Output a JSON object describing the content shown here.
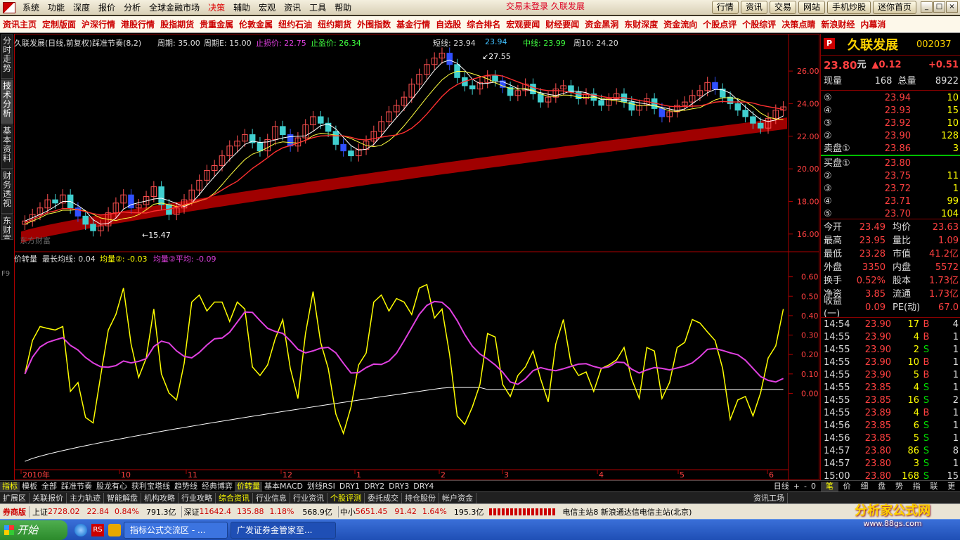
{
  "menubar": {
    "items": [
      "系统",
      "功能",
      "深度",
      "报价",
      "分析",
      "全球金融市场",
      "决策",
      "辅助",
      "宏观",
      "资讯",
      "工具",
      "帮助"
    ],
    "center_title": "交易未登录 久联发展",
    "right_buttons": [
      "行情",
      "资讯",
      "交易",
      "网站",
      "手机炒股",
      "迷你首页"
    ]
  },
  "quick_bar": [
    "资讯主页",
    "定制版面",
    "沪深行情",
    "港股行情",
    "股指期货",
    "贵重金属",
    "伦敦金属",
    "纽约石油",
    "纽约期货",
    "外围指数",
    "基金行情",
    "自选股",
    "综合排名",
    "宏观要闻",
    "财经要闻",
    "资金黑洞",
    "东财深度",
    "资金流向",
    "个股点评",
    "个股综评",
    "决策点睛",
    "新浪财经",
    "内幕消"
  ],
  "left_tabs": [
    "分时走势",
    "技术分析",
    "基本资料",
    "财务透视",
    "东财富"
  ],
  "left_f9": "F9",
  "main_chart": {
    "title": "久联发展(日线,前复权)踩准节奏(8,2)",
    "period_label": "周期:",
    "period_value": "35.00",
    "period_e_label": "周期E:",
    "period_e_value": "15.00",
    "stop_loss_label": "止损价:",
    "stop_loss_value": "22.75",
    "take_profit_label": "止盈价:",
    "take_profit_value": "26.34",
    "short_label": "短线:",
    "short_value": "23.94",
    "short_value2": "23.94",
    "mid_label": "中线:",
    "mid_value": "23.99",
    "week_label": "周10:",
    "week_value": "24.20",
    "high_marker": "27.55",
    "low_marker": "15.47",
    "watermark_text": "东方财富"
  },
  "indicator": {
    "name": "价转量",
    "long_ma_label": "最长均线:",
    "long_ma_value": "0.04",
    "ma2_label": "均量②:",
    "ma2_value": "-0.03",
    "ma2_avg_label": "均量②平均:",
    "ma2_avg_value": "-0.09"
  },
  "chart_data": [
    {
      "type": "candlestick",
      "title": "久联发展(日线,前复权)",
      "ylim": [
        15,
        27.6
      ],
      "y_ticks": [
        16,
        18,
        20,
        22,
        24,
        26
      ],
      "x_labels": [
        "2010年",
        "10",
        "11",
        "12",
        "1",
        "2",
        "3",
        "4",
        "5",
        "6"
      ],
      "ohlc_close_path": [
        16.8,
        17.2,
        17.6,
        18.1,
        17.9,
        18.4,
        17.6,
        17.1,
        16.6,
        16.2,
        16.5,
        17.3,
        17.9,
        18.4,
        17.6,
        17.8,
        18.3,
        18.9,
        17.8,
        17.2,
        17.6,
        18.1,
        18.7,
        19.3,
        19.9,
        20.2,
        20.8,
        21.4,
        21.7,
        22.1,
        21.6,
        21.1,
        21.8,
        22.6,
        22.1,
        21.4,
        21.9,
        22.7,
        23.2,
        22.8,
        22.3,
        21.5,
        21.1,
        20.8,
        21.2,
        21.7,
        22.3,
        22.9,
        23.5,
        23.9,
        24.4,
        25.2,
        25.8,
        26.4,
        26.8,
        27.1,
        26.4,
        25.6,
        25.1,
        24.9,
        25.3,
        25.7,
        25.4,
        25.0,
        24.5,
        24.8,
        25.2,
        24.6,
        24.1,
        24.4,
        24.9,
        25.1,
        24.7,
        24.3,
        24.6,
        24.2,
        23.9,
        24.3,
        24.6,
        24.1,
        23.6,
        23.9,
        24.3,
        23.7,
        23.2,
        23.5,
        23.9,
        24.1,
        24.5,
        24.8,
        25.3,
        24.9,
        24.4,
        24.0,
        23.6,
        23.2,
        22.8,
        22.5,
        23.1,
        23.6,
        23.8
      ],
      "ma_long_range": [
        15.8,
        22.8
      ],
      "indicator_ylim": [
        -0.4,
        0.7
      ],
      "indicator_y_ticks": [
        0.6,
        0.5,
        0.4,
        0.3,
        0.2,
        0.1,
        0.0
      ],
      "series": [
        {
          "name": "价转量",
          "color": "#ffff00"
        },
        {
          "name": "均量②",
          "color": "#e040e0"
        },
        {
          "name": "均量②平均",
          "color": "#ffffff"
        }
      ]
    }
  ],
  "right_panel": {
    "stock_name": "久联发展",
    "stock_code": "002037",
    "price": "23.80",
    "price_unit": "元",
    "change": "▲0.12",
    "change_pct": "+0.51",
    "volume_now_label": "现量",
    "volume_now": "168",
    "volume_total_label": "总量",
    "volume_total": "8922",
    "asks": [
      {
        "lvl": "⑤",
        "price": "23.94",
        "vol": "10"
      },
      {
        "lvl": "④",
        "price": "23.93",
        "vol": "15"
      },
      {
        "lvl": "③",
        "price": "23.92",
        "vol": "10"
      },
      {
        "lvl": "②",
        "price": "23.90",
        "vol": "128"
      },
      {
        "lvl": "卖盘①",
        "price": "23.86",
        "vol": "3"
      }
    ],
    "bids": [
      {
        "lvl": "买盘①",
        "price": "23.80",
        "vol": ""
      },
      {
        "lvl": "②",
        "price": "23.75",
        "vol": "11"
      },
      {
        "lvl": "③",
        "price": "23.72",
        "vol": "1"
      },
      {
        "lvl": "④",
        "price": "23.71",
        "vol": "99"
      },
      {
        "lvl": "⑤",
        "price": "23.70",
        "vol": "104"
      }
    ],
    "stats": [
      {
        "l1": "今开",
        "v1": "23.49",
        "l2": "均价",
        "v2": "23.63"
      },
      {
        "l1": "最高",
        "v1": "23.95",
        "l2": "量比",
        "v2": "1.09"
      },
      {
        "l1": "最低",
        "v1": "23.28",
        "l2": "市值",
        "v2": "41.2亿"
      },
      {
        "l1": "外盘",
        "v1": "3350",
        "l2": "内盘",
        "v2": "5572"
      },
      {
        "l1": "换手",
        "v1": "0.52%",
        "l2": "股本",
        "v2": "1.73亿"
      },
      {
        "l1": "净资",
        "v1": "3.85",
        "l2": "流通",
        "v2": "1.73亿"
      },
      {
        "l1": "收益(一)",
        "v1": "0.09",
        "l2": "PE(动)",
        "v2": "67.0"
      }
    ],
    "ticks": [
      {
        "t": "14:54",
        "p": "23.90",
        "v": "17",
        "d": "B",
        "n": "4"
      },
      {
        "t": "14:55",
        "p": "23.90",
        "v": "4",
        "d": "B",
        "n": "1"
      },
      {
        "t": "14:55",
        "p": "23.90",
        "v": "2",
        "d": "S",
        "n": "1"
      },
      {
        "t": "14:55",
        "p": "23.90",
        "v": "10",
        "d": "B",
        "n": "1"
      },
      {
        "t": "14:55",
        "p": "23.90",
        "v": "5",
        "d": "B",
        "n": "1"
      },
      {
        "t": "14:55",
        "p": "23.85",
        "v": "4",
        "d": "S",
        "n": "1"
      },
      {
        "t": "14:55",
        "p": "23.85",
        "v": "16",
        "d": "S",
        "n": "2"
      },
      {
        "t": "14:55",
        "p": "23.89",
        "v": "4",
        "d": "B",
        "n": "1"
      },
      {
        "t": "14:56",
        "p": "23.85",
        "v": "6",
        "d": "S",
        "n": "1"
      },
      {
        "t": "14:56",
        "p": "23.85",
        "v": "5",
        "d": "S",
        "n": "1"
      },
      {
        "t": "14:57",
        "p": "23.80",
        "v": "86",
        "d": "S",
        "n": "8"
      },
      {
        "t": "14:57",
        "p": "23.80",
        "v": "3",
        "d": "S",
        "n": "1"
      },
      {
        "t": "15:00",
        "p": "23.80",
        "v": "168",
        "d": "S",
        "n": "15"
      }
    ],
    "bottom_tabs": [
      "笔",
      "价",
      "细",
      "盘",
      "势",
      "指",
      "联",
      "更"
    ]
  },
  "bottom_tabs": [
    "指标",
    "模板",
    "全部",
    "踩准节奏",
    "股龙有心",
    "获利宝塔线",
    "趋势线",
    "经典博弈",
    "价转量",
    "基本MACD",
    "划线RSI",
    "DRY1",
    "DRY2",
    "DRY3",
    "DRY4"
  ],
  "bottom_right": {
    "daily": "日线",
    "plus": "+",
    "minus": "-",
    "zero": "0"
  },
  "ext_tabs": [
    "扩展区",
    "关联报价",
    "主力轨迹",
    "智能解盘",
    "机构攻略",
    "行业攻略",
    "综合资讯",
    "行业信息",
    "行业资讯",
    "个股评测",
    "委托成交",
    "持仓股份",
    "帐户资金"
  ],
  "ext_right": "资讯工场",
  "status_bar": {
    "broker": "券商版",
    "sh_label": "上证",
    "sh_value": "2728.02",
    "sh_change": "22.84",
    "sh_pct": "0.84%",
    "sh_amount": "791.3亿",
    "sz_label": "深证",
    "sz_value": "11642.4",
    "sz_change": "135.88",
    "sz_pct": "1.18%",
    "sz_amount": "568.9亿",
    "zx_label": "中小",
    "zx_value": "5651.45",
    "zx_change": "91.42",
    "zx_pct": "1.64%",
    "zx_amount": "195.3亿",
    "server": "电信主站8 新浪通达信电信主站(北京)"
  },
  "taskbar": {
    "start": "开始",
    "tasks": [
      "指标公式交流区 - ...",
      "广发证券金管家至..."
    ]
  },
  "watermark": {
    "title": "分析家公式网",
    "url": "www.88gs.com"
  }
}
